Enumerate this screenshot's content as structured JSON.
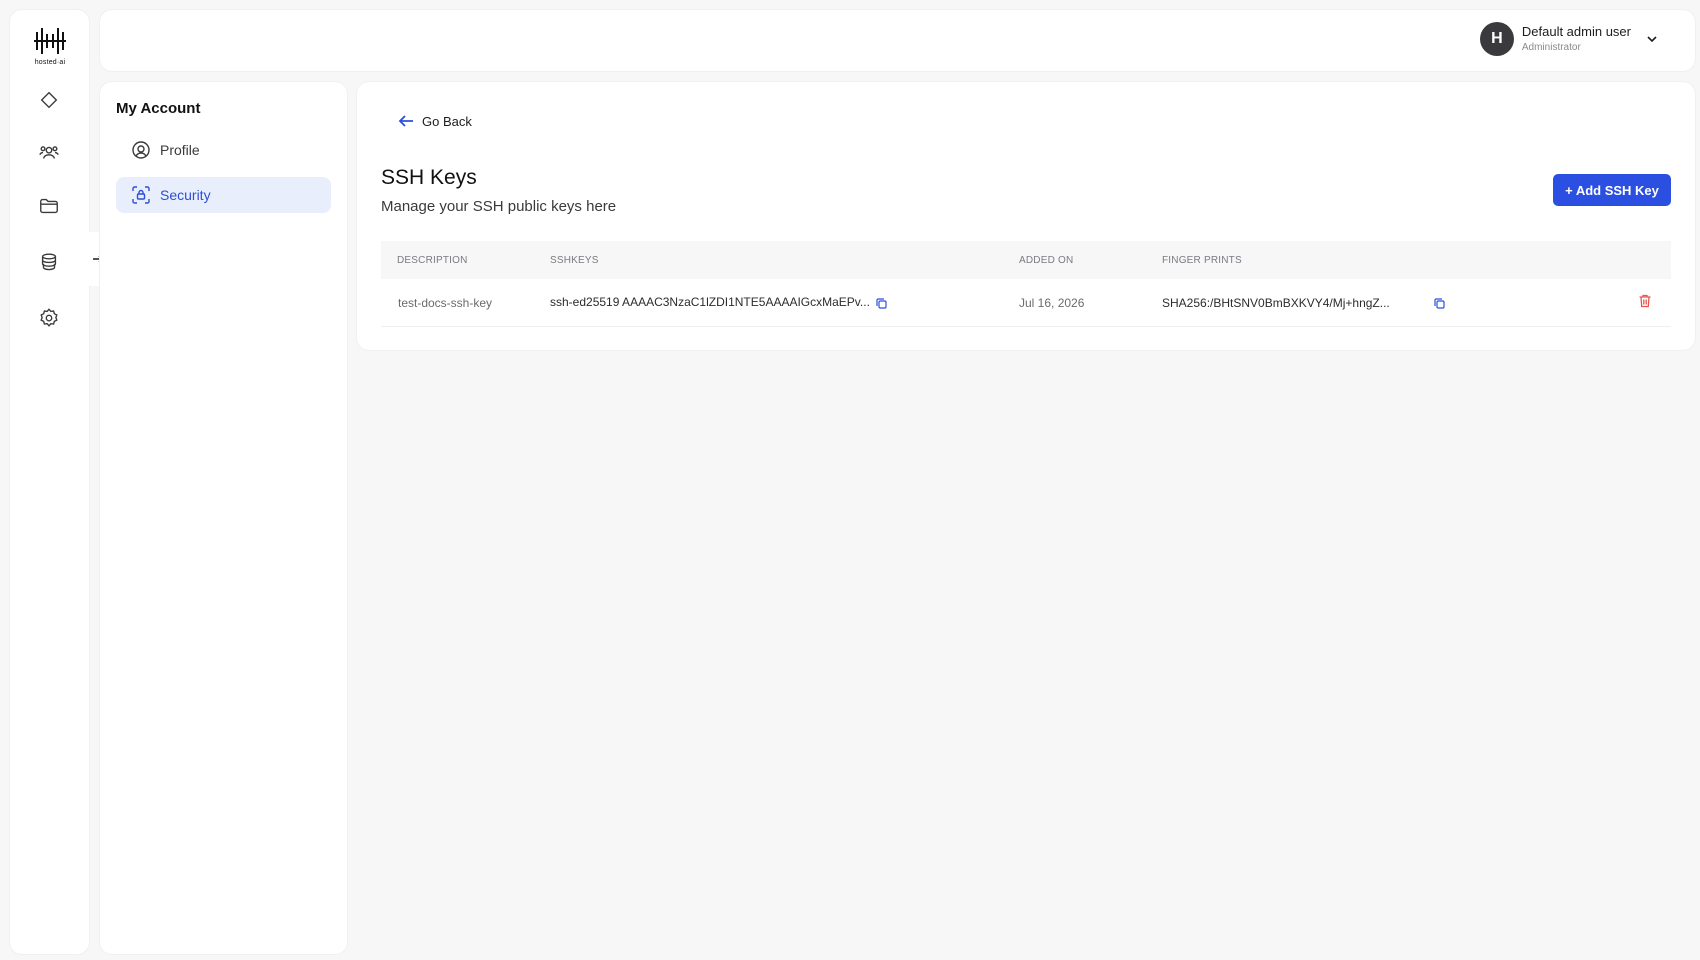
{
  "brand": {
    "logo_text": "hosted·ai"
  },
  "rail": {
    "icons": [
      "diamond-icon",
      "users-icon",
      "folder-icon",
      "database-icon",
      "settings-icon"
    ]
  },
  "topbar": {
    "user_initial": "H",
    "user_name": "Default admin user",
    "user_role": "Administrator"
  },
  "account": {
    "title": "My Account",
    "items": [
      {
        "label": "Profile",
        "icon": "user-circle-icon",
        "active": false
      },
      {
        "label": "Security",
        "icon": "lock-scan-icon",
        "active": true
      }
    ]
  },
  "main": {
    "go_back": "Go Back",
    "title": "SSH Keys",
    "subtitle": "Manage your SSH public keys here",
    "add_button": "+ Add SSH Key",
    "table": {
      "columns": [
        "DESCRIPTION",
        "SSHKEYS",
        "ADDED ON",
        "FINGER PRINTS"
      ],
      "rows": [
        {
          "description": "test-docs-ssh-key",
          "sshkey": "ssh-ed25519 AAAAC3NzaC1lZDI1NTE5AAAAIGcxMaEPv...",
          "added_on": "Jul 16, 2026",
          "fingerprint": "SHA256:/BHtSNV0BmBXKVY4/Mj+hngZ..."
        }
      ]
    }
  },
  "colors": {
    "accent": "#2b4fe0",
    "active_bg": "#e9eefc",
    "danger": "#e8554e"
  }
}
